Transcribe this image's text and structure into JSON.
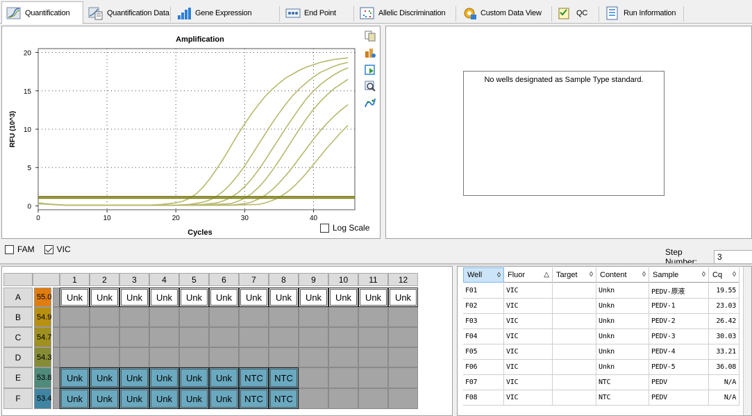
{
  "tabs": [
    {
      "label": "Quantification",
      "icon": "amplification-curve-icon",
      "active": true
    },
    {
      "label": "Quantification Data",
      "icon": "quantification-data-icon",
      "active": false
    },
    {
      "label": "Gene Expression",
      "icon": "bar-chart-icon",
      "active": false
    },
    {
      "label": "End Point",
      "icon": "end-point-icon",
      "active": false
    },
    {
      "label": "Allelic Discrimination",
      "icon": "scatter-plot-icon",
      "active": false
    },
    {
      "label": "Custom Data View",
      "icon": "custom-view-icon",
      "active": false
    },
    {
      "label": "QC",
      "icon": "qc-checklist-icon",
      "active": false
    },
    {
      "label": "Run Information",
      "icon": "run-information-icon",
      "active": false
    }
  ],
  "chart_data": {
    "type": "line",
    "title": "Amplification",
    "xlabel": "Cycles",
    "ylabel": "RFU (10^3)",
    "xlim": [
      0,
      46
    ],
    "ylim": [
      -0.5,
      20.5
    ],
    "xticks": [
      0,
      10,
      20,
      30,
      40
    ],
    "yticks": [
      0,
      5,
      10,
      15,
      20
    ],
    "grid": "dotted",
    "series": [
      {
        "x": [
          0,
          2,
          4,
          6,
          8,
          10,
          12,
          14,
          16,
          18,
          20,
          21,
          22,
          23,
          24,
          25,
          26,
          27,
          28,
          29,
          30,
          31,
          32,
          33,
          34,
          35,
          36,
          37,
          38,
          39,
          40,
          41,
          42,
          43,
          44,
          45
        ],
        "values": [
          0.4,
          0.2,
          0.1,
          0.1,
          0.1,
          0.1,
          0.1,
          0.1,
          0.1,
          0.2,
          0.4,
          0.6,
          1.0,
          1.6,
          2.5,
          3.6,
          4.9,
          6.3,
          7.8,
          9.3,
          10.7,
          12.0,
          13.2,
          14.3,
          15.2,
          16.0,
          16.7,
          17.2,
          17.7,
          18.1,
          18.4,
          18.7,
          18.9,
          19.1,
          19.2,
          19.3
        ]
      },
      {
        "x": [
          0,
          4,
          8,
          12,
          16,
          20,
          22,
          24,
          25,
          26,
          27,
          28,
          29,
          30,
          31,
          32,
          33,
          34,
          35,
          36,
          37,
          38,
          39,
          40,
          41,
          42,
          43,
          44,
          45
        ],
        "values": [
          0.3,
          0.1,
          0.1,
          0.1,
          0.1,
          0.1,
          0.2,
          0.5,
          0.8,
          1.3,
          2.0,
          2.9,
          4.0,
          5.2,
          6.6,
          8.0,
          9.4,
          10.8,
          12.1,
          13.3,
          14.4,
          15.3,
          16.1,
          16.8,
          17.4,
          17.8,
          18.2,
          18.5,
          18.7
        ]
      },
      {
        "x": [
          0,
          4,
          8,
          12,
          16,
          20,
          24,
          26,
          27,
          28,
          29,
          30,
          31,
          32,
          33,
          34,
          35,
          36,
          37,
          38,
          39,
          40,
          41,
          42,
          43,
          44,
          45
        ],
        "values": [
          0.3,
          0.1,
          0.1,
          0.1,
          0.1,
          0.1,
          0.2,
          0.4,
          0.7,
          1.1,
          1.7,
          2.5,
          3.5,
          4.7,
          6.0,
          7.4,
          8.8,
          10.2,
          11.5,
          12.8,
          14.0,
          15.0,
          15.8,
          16.5,
          17.1,
          17.6,
          18.0
        ]
      },
      {
        "x": [
          0,
          4,
          8,
          12,
          16,
          20,
          24,
          28,
          29,
          30,
          31,
          32,
          33,
          34,
          35,
          36,
          37,
          38,
          39,
          40,
          41,
          42,
          43,
          44,
          45
        ],
        "values": [
          0.3,
          0.1,
          0.1,
          0.1,
          0.1,
          0.1,
          0.1,
          0.3,
          0.6,
          1.0,
          1.6,
          2.4,
          3.4,
          4.6,
          5.9,
          7.3,
          8.7,
          10.1,
          11.4,
          12.6,
          13.6,
          14.5,
          15.3,
          15.9,
          16.5
        ]
      },
      {
        "x": [
          0,
          4,
          8,
          12,
          16,
          20,
          24,
          28,
          30,
          31,
          32,
          33,
          34,
          35,
          36,
          37,
          38,
          39,
          40,
          41,
          42,
          43,
          44,
          45
        ],
        "values": [
          0.3,
          0.1,
          0.1,
          0.1,
          0.1,
          0.1,
          0.1,
          0.1,
          0.3,
          0.5,
          0.9,
          1.4,
          2.1,
          3.0,
          4.0,
          5.1,
          6.3,
          7.5,
          8.7,
          9.8,
          10.8,
          11.7,
          12.5,
          13.2
        ]
      },
      {
        "x": [
          0,
          4,
          8,
          12,
          16,
          20,
          24,
          28,
          32,
          33,
          34,
          35,
          36,
          37,
          38,
          39,
          40,
          41,
          42,
          43,
          44,
          45
        ],
        "values": [
          0.3,
          0.1,
          0.1,
          0.1,
          0.1,
          0.1,
          0.1,
          0.1,
          0.2,
          0.4,
          0.7,
          1.1,
          1.7,
          2.4,
          3.3,
          4.3,
          5.4,
          6.5,
          7.6,
          8.6,
          9.6,
          10.5
        ]
      },
      {
        "x": [
          0,
          46
        ],
        "values": [
          1.2,
          1.2
        ]
      },
      {
        "x": [
          0,
          46
        ],
        "values": [
          1.0,
          1.0
        ]
      }
    ]
  },
  "chart_colors": {
    "curve": "#b8b86e",
    "threshold": "#7a7a10"
  },
  "chart_icons": [
    "copy-icon",
    "export-icon",
    "refresh-icon",
    "zoom-icon",
    "curve-fit-icon"
  ],
  "log_scale": {
    "label": "Log Scale",
    "checked": false
  },
  "std_message": "No wells designated as Sample Type standard.",
  "fluors": [
    {
      "label": "FAM",
      "checked": false
    },
    {
      "label": "VIC",
      "checked": true
    }
  ],
  "step": {
    "label": "Step Number:",
    "value": "3"
  },
  "plate": {
    "columns": [
      "1",
      "2",
      "3",
      "4",
      "5",
      "6",
      "7",
      "8",
      "9",
      "10",
      "11",
      "12"
    ],
    "rows": [
      {
        "label": "A",
        "temp": "55.0",
        "temp_color": "#e07d10",
        "wells": [
          "Unk",
          "Unk",
          "Unk",
          "Unk",
          "Unk",
          "Unk",
          "Unk",
          "Unk",
          "Unk",
          "Unk",
          "Unk",
          "Unk"
        ]
      },
      {
        "label": "B",
        "temp": "54.9",
        "temp_color": "#b8900f",
        "wells": [
          "",
          "",
          "",
          "",
          "",
          "",
          "",
          "",
          "",
          "",
          "",
          ""
        ]
      },
      {
        "label": "C",
        "temp": "54.7",
        "temp_color": "#a09020",
        "wells": [
          "",
          "",
          "",
          "",
          "",
          "",
          "",
          "",
          "",
          "",
          "",
          ""
        ]
      },
      {
        "label": "D",
        "temp": "54.3",
        "temp_color": "#868c35",
        "wells": [
          "",
          "",
          "",
          "",
          "",
          "",
          "",
          "",
          "",
          "",
          "",
          ""
        ]
      },
      {
        "label": "E",
        "temp": "53.8",
        "temp_color": "#4f8a7a",
        "wells": [
          "Unk",
          "Unk",
          "Unk",
          "Unk",
          "Unk",
          "Unk",
          "NTC",
          "NTC",
          "",
          "",
          "",
          ""
        ]
      },
      {
        "label": "F",
        "temp": "53.4",
        "temp_color": "#3f84a0",
        "wells": [
          "Unk",
          "Unk",
          "Unk",
          "Unk",
          "Unk",
          "Unk",
          "NTC",
          "NTC",
          "",
          "",
          "",
          ""
        ]
      }
    ],
    "colors": {
      "unknown_top": "#ffffff",
      "unknown_active": "#6aa9c0",
      "empty": "#a5a5a5"
    }
  },
  "table": {
    "headers": [
      {
        "label": "Well",
        "sort": "◊",
        "selected": true
      },
      {
        "label": "Fluor",
        "sort": "△",
        "selected": false
      },
      {
        "label": "Target",
        "sort": "◊",
        "selected": false
      },
      {
        "label": "Content",
        "sort": "◊",
        "selected": false
      },
      {
        "label": "Sample",
        "sort": "◊",
        "selected": false
      },
      {
        "label": "Cq",
        "sort": "◊",
        "selected": false
      }
    ],
    "rows": [
      [
        "F01",
        "VIC",
        "",
        "Unkn",
        "PEDV-原液",
        "19.55"
      ],
      [
        "F02",
        "VIC",
        "",
        "Unkn",
        "PEDV-1",
        "23.03"
      ],
      [
        "F03",
        "VIC",
        "",
        "Unkn",
        "PEDV-2",
        "26.42"
      ],
      [
        "F04",
        "VIC",
        "",
        "Unkn",
        "PEDV-3",
        "30.03"
      ],
      [
        "F05",
        "VIC",
        "",
        "Unkn",
        "PEDV-4",
        "33.21"
      ],
      [
        "F06",
        "VIC",
        "",
        "Unkn",
        "PEDV-5",
        "36.08"
      ],
      [
        "F07",
        "VIC",
        "",
        "NTC",
        "PEDV",
        "N/A"
      ],
      [
        "F08",
        "VIC",
        "",
        "NTC",
        "PEDV",
        "N/A"
      ]
    ]
  }
}
